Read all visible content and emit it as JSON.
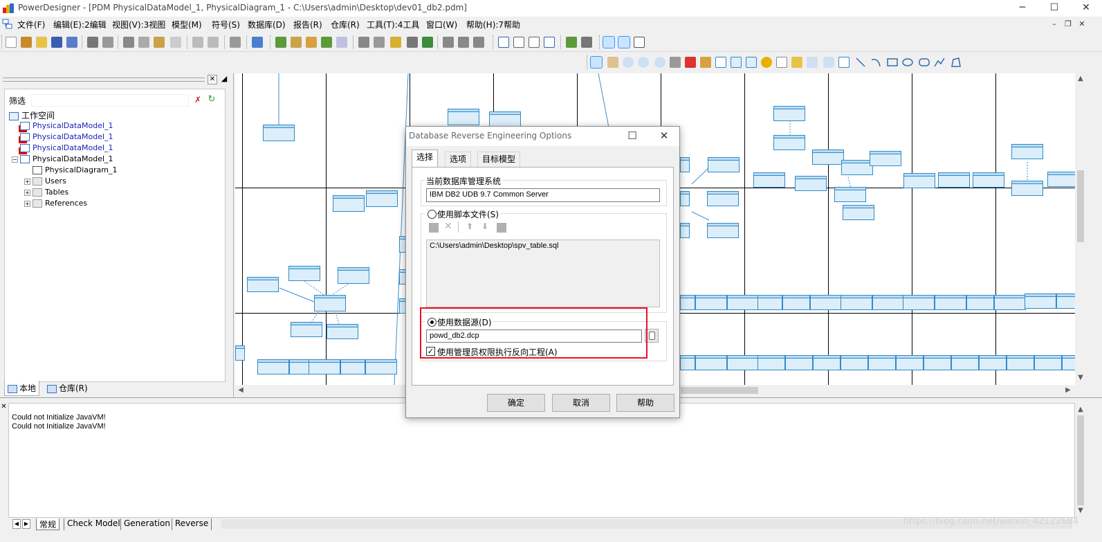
{
  "window": {
    "title": "PowerDesigner - [PDM PhysicalDataModel_1, PhysicalDiagram_1 - C:\\Users\\admin\\Desktop\\dev01_db2.pdm]",
    "minimize": "─",
    "maximize": "☐",
    "close": "✕"
  },
  "menu": {
    "items": [
      "文件(F)",
      "编辑(E):2编辑",
      "视图(V):3视图",
      "模型(M)",
      "符号(S)",
      "数据库(D)",
      "报告(R)",
      "仓库(R)",
      "工具(T):4工具",
      "窗口(W)",
      "帮助(H):7帮助"
    ],
    "mdi_minimize": "–",
    "mdi_restore": "❐",
    "mdi_close": "✕"
  },
  "browser": {
    "filter_label": "筛选",
    "workspace_label": "工作空间",
    "models": [
      "PhysicalDataModel_1",
      "PhysicalDataModel_1",
      "PhysicalDataModel_1",
      "PhysicalDataModel_1"
    ],
    "diagram": "PhysicalDiagram_1",
    "folders": [
      "Users",
      "Tables",
      "References"
    ],
    "tab_local": "本地",
    "tab_repo": "仓库(R)"
  },
  "output": {
    "lines": [
      "Could not Initialize JavaVM!",
      "Could not Initialize JavaVM!"
    ],
    "tabs": [
      "常规",
      "Check Model",
      "Generation",
      "Reverse"
    ]
  },
  "watermark": "https://blog.csdn.net/weixin_42122684",
  "dialog": {
    "title": "Database Reverse Engineering Options",
    "tabs": [
      "选择",
      "选项",
      "目标模型"
    ],
    "dbms_group_label": "当前数据库管理系统",
    "dbms_value": "IBM DB2 UDB 9.7 Common Server",
    "script_radio_label": "使用脚本文件(S)",
    "script_file": "C:\\Users\\admin\\Desktop\\spv_table.sql",
    "datasource_radio_label": "使用数据源(D)",
    "datasource_value": "powd_db2.dcp",
    "admin_checkbox_label": "使用管理员权限执行反向工程(A)",
    "admin_checked": true,
    "ok_label": "确定",
    "cancel_label": "取消",
    "help_label": "帮助"
  },
  "colors": {
    "table_border": "#2e8bc9",
    "table_fill": "#dceefa",
    "highlight_red": "#e81123"
  }
}
